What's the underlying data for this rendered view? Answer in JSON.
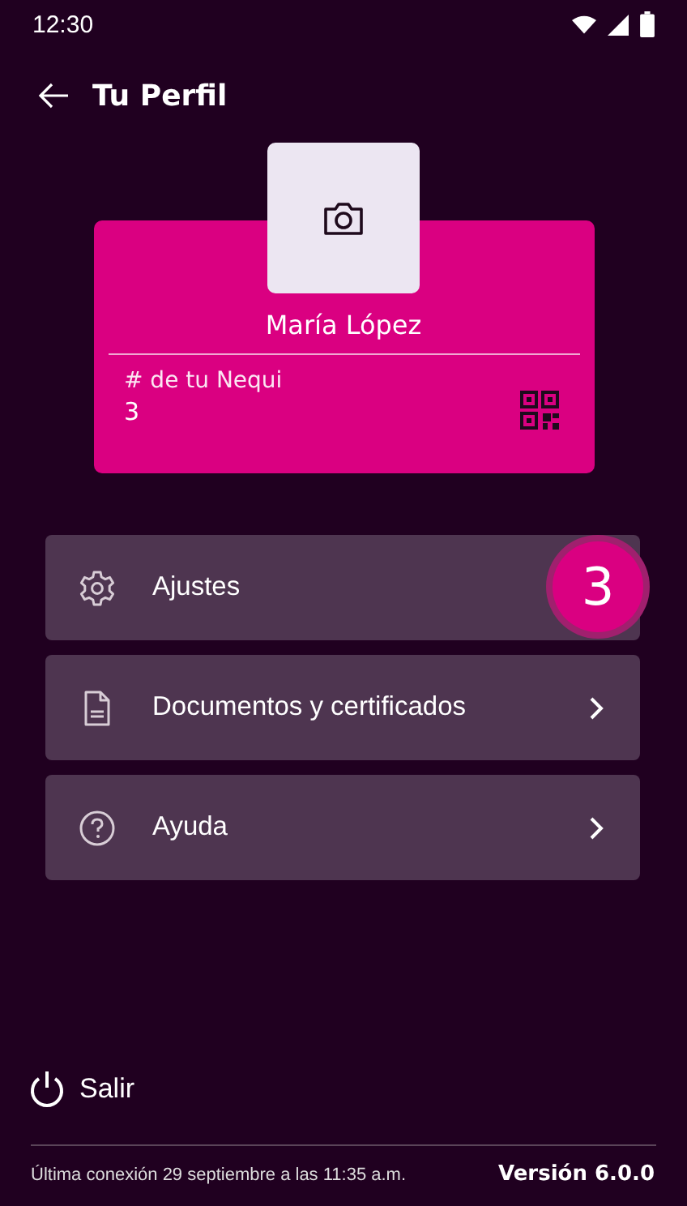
{
  "status_bar": {
    "time": "12:30"
  },
  "header": {
    "title": "Tu Perfil"
  },
  "profile": {
    "name": "María López",
    "account_label": "# de tu Nequi",
    "account_number": "3"
  },
  "menu": [
    {
      "kind": "settings",
      "label": "Ajustes",
      "badge": "3"
    },
    {
      "kind": "document",
      "label": "Documentos y certificados"
    },
    {
      "kind": "help",
      "label": "Ayuda"
    }
  ],
  "logout": {
    "label": "Salir"
  },
  "footer": {
    "last_login": "Última conexión 29 septiembre a las 11:35 a.m.",
    "version": "Versión 6.0.0"
  }
}
